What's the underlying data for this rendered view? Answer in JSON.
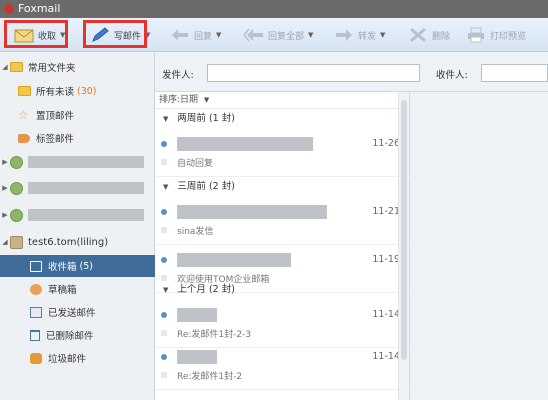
{
  "window": {
    "title": "Foxmail"
  },
  "toolbar": {
    "receive": "收取",
    "compose": "写邮件",
    "reply": "回复",
    "reply_all": "回复全部",
    "forward": "转发",
    "delete": "删除",
    "print_preview": "打印预览"
  },
  "search": {
    "sender_label": "发件人:",
    "recipient_label": "收件人:"
  },
  "sidebar": {
    "common_folders": "常用文件夹",
    "all_unread": "所有未读",
    "all_unread_count": "(30)",
    "pinned": "置顶邮件",
    "tagged": "标签邮件",
    "account": "test6.tom(liling)",
    "inbox": "收件箱",
    "inbox_count": "(5)",
    "drafts": "草稿箱",
    "sent": "已发送邮件",
    "deleted": "已删除邮件",
    "junk": "垃圾邮件"
  },
  "list": {
    "sort_label": "排序:日期",
    "groups": [
      {
        "label": "两周前 (1 封)"
      },
      {
        "label": "三周前 (2 封)"
      },
      {
        "label": "上个月 (2 封)"
      }
    ],
    "messages": [
      {
        "date": "11-26",
        "subject": "自动回复"
      },
      {
        "date": "11-21",
        "subject": "sina发信"
      },
      {
        "date": "11-19",
        "subject": "欢迎使用TOM企业邮箱"
      },
      {
        "date": "11-14",
        "subject": "Re:发邮件1封-2-3"
      },
      {
        "date": "11-14",
        "subject": "Re:发邮件1封-2"
      }
    ]
  },
  "colors": {
    "highlight": "#e5322d",
    "selected": "#3f6c9a",
    "unread_count": "#e07a16"
  }
}
